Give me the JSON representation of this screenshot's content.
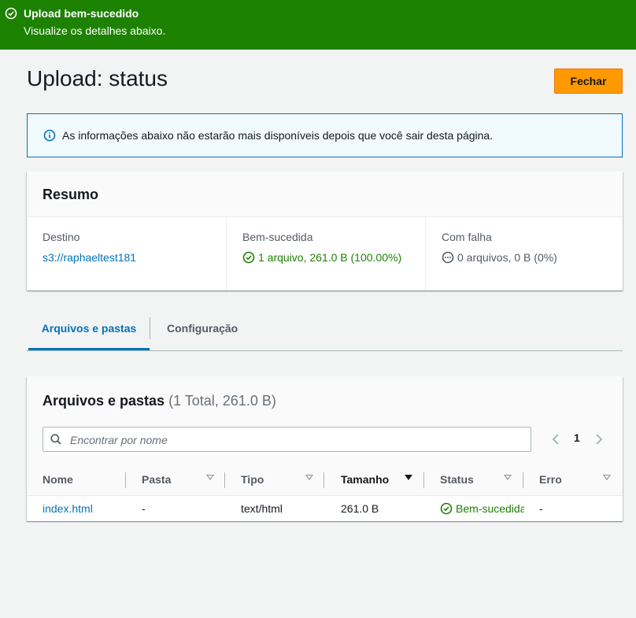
{
  "flash": {
    "title": "Upload bem-sucedido",
    "message": "Visualize os detalhes abaixo.",
    "color": "#1d8102",
    "icon": "check-circle-icon"
  },
  "page": {
    "title": "Upload: status",
    "close_label": "Fechar"
  },
  "info_alert": {
    "icon": "info-icon",
    "text": "As informações abaixo não estarão mais disponíveis depois que você sair desta página."
  },
  "summary": {
    "title": "Resumo",
    "destination": {
      "label": "Destino",
      "value": "s3://raphaeltest181"
    },
    "succeeded": {
      "label": "Bem-sucedida",
      "value": "1 arquivo, 261.0 B (100.00%)"
    },
    "failed": {
      "label": "Com falha",
      "value": "0 arquivos, 0 B (0%)"
    }
  },
  "tabs": [
    {
      "label": "Arquivos e pastas",
      "active": true
    },
    {
      "label": "Configuração",
      "active": false
    }
  ],
  "files": {
    "title": "Arquivos e pastas",
    "count": "(1 Total, 261.0 B)",
    "search_placeholder": "Encontrar por nome",
    "page": "1",
    "columns": [
      "Nome",
      "Pasta",
      "Tipo",
      "Tamanho",
      "Status",
      "Erro"
    ],
    "rows": [
      {
        "name": "index.html",
        "folder": "-",
        "type": "text/html",
        "size": "261.0 B",
        "status": "Bem-sucedida",
        "error": "-"
      }
    ]
  },
  "colors": {
    "accent": "#ff9900",
    "link": "#0073bb",
    "success": "#1d8102"
  }
}
